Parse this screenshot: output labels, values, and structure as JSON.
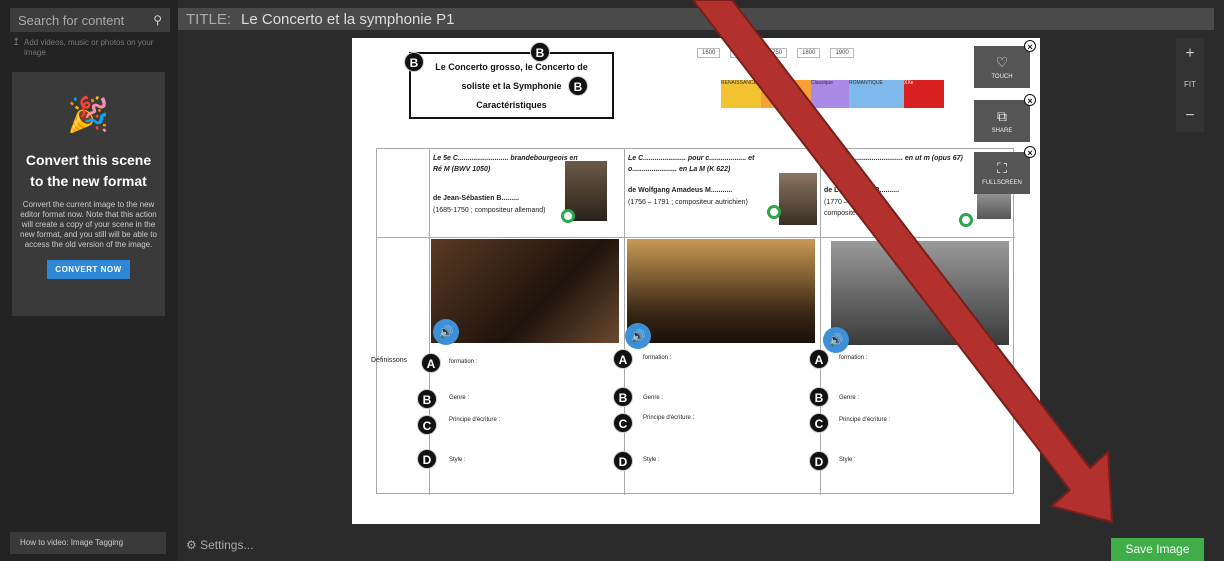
{
  "sidebar": {
    "search_placeholder": "Search for content",
    "hint": "Add videos, music or photos on your image",
    "promo": {
      "title": "Convert this scene to the new format",
      "body": "Convert the current image to the new editor format now. Note that this action will create a copy of your scene in the new format, and you still will be able to access the old version of the image.",
      "button": "CONVERT NOW"
    },
    "howto": "How to video: Image Tagging"
  },
  "header": {
    "title_label": "TITLE:",
    "title_value": "Le Concerto et la symphonie P1"
  },
  "canvas": {
    "title_line1": "Le Concerto grosso,  le Concerto de",
    "title_line2": "soliste et la Symphonie",
    "title_line3": "Caractéristiques",
    "timeline_years": [
      "1600",
      "1600",
      "1750",
      "1800",
      "1900"
    ],
    "timeline_labels": [
      "RENAISSANCE",
      "BAROQUE",
      "Classique",
      "ROMANTIQUE",
      "XXe"
    ],
    "col1_title": "Le 5e C.......................... brandebourgeois en Ré M (BWV 1050)",
    "col1_author": "de Jean-Sébastien B.........",
    "col1_dates": "(1685-1750 ; compositeur allemand)",
    "col2_title": "Le C...................... pour c................... et o....................... en La M (K 622)",
    "col2_author": "de Wolfgang Amadeus M...........",
    "col2_dates": "(1756 – 1791 ; compositeur autrichien)",
    "col3_title": "La S................................. en ut m (opus 67)",
    "col3_author": "de Ludwig van B..........",
    "col3_dates": "(1770 – 1827 ; compositeur allemand)",
    "row_label": "Définissons",
    "field_formation": "formation :",
    "field_genre": "Genre :",
    "field_principe": "Principe d'écriture :",
    "field_style": "Style :",
    "badge_a": "A",
    "badge_b": "B",
    "badge_c": "C",
    "badge_d": "D"
  },
  "actions": {
    "touch": "TOUCH",
    "share": "SHARE",
    "fullscreen": "FULLSCREEN"
  },
  "zoom": {
    "plus": "+",
    "fit": "FIT",
    "minus": "−"
  },
  "footer": {
    "settings": "Settings...",
    "save": "Save Image"
  },
  "colors": {
    "accent_blue": "#2f87d8",
    "save_green": "#3fae49",
    "arrow_red": "#b3312c"
  }
}
